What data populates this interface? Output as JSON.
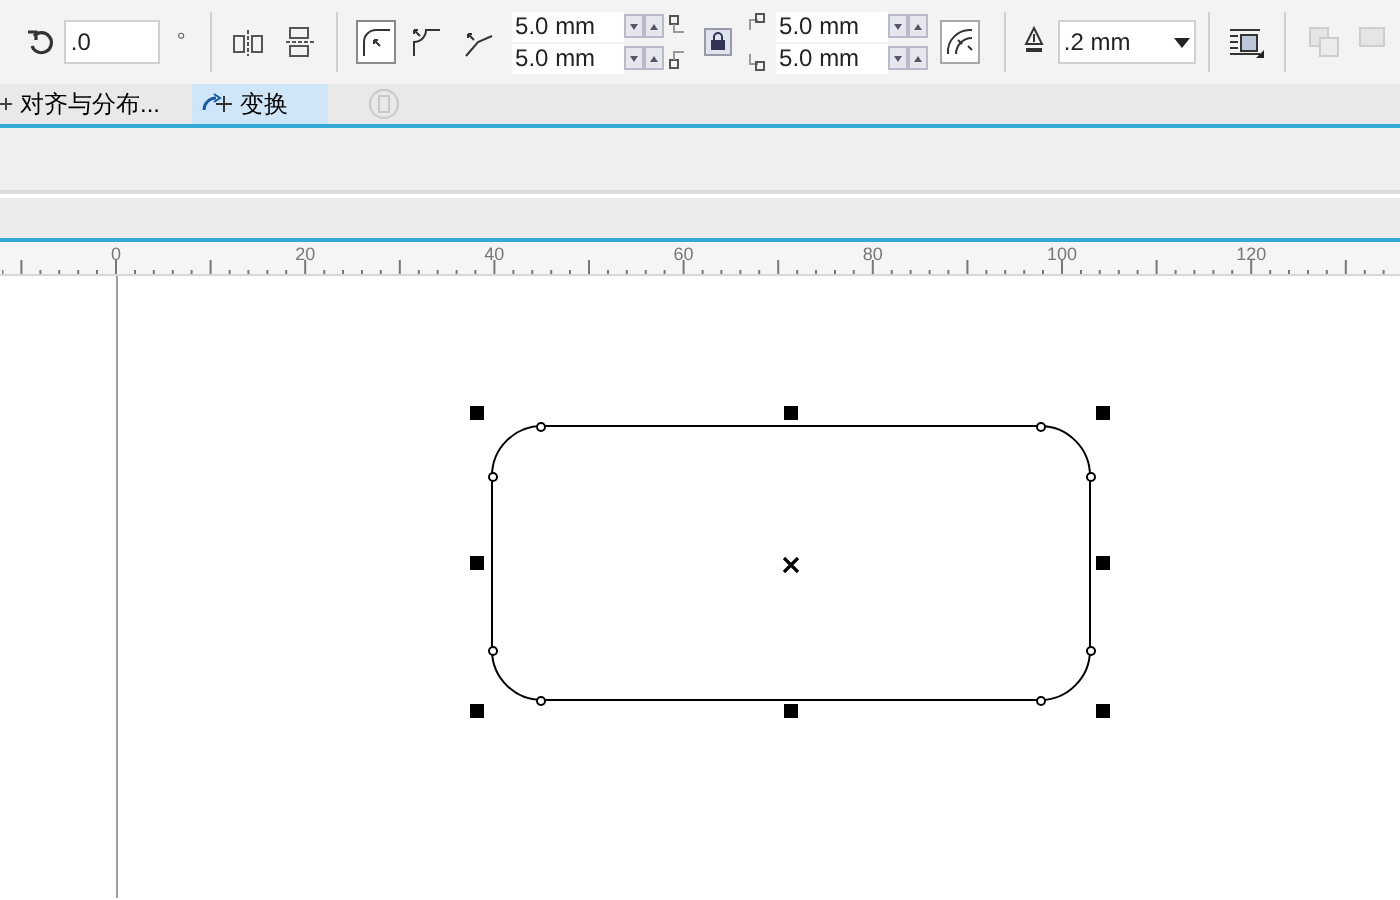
{
  "toolbar": {
    "rotation": {
      "value": ".0",
      "unit": "°"
    },
    "corner_types": [
      {
        "selected": true
      },
      {
        "selected": false
      },
      {
        "selected": false
      }
    ],
    "corner_radii_left": [
      "5.0 mm",
      "5.0 mm"
    ],
    "corner_radii_right": [
      "5.0 mm",
      "5.0 mm"
    ],
    "lock_locked": true,
    "outline_width": ".2 mm"
  },
  "docker_tabs": [
    {
      "label": "对齐与分布...",
      "selected": false
    },
    {
      "label": "变换",
      "selected": true
    }
  ],
  "ruler_labels": [
    "0",
    "20",
    "40",
    "60",
    "80",
    "100",
    "120"
  ]
}
